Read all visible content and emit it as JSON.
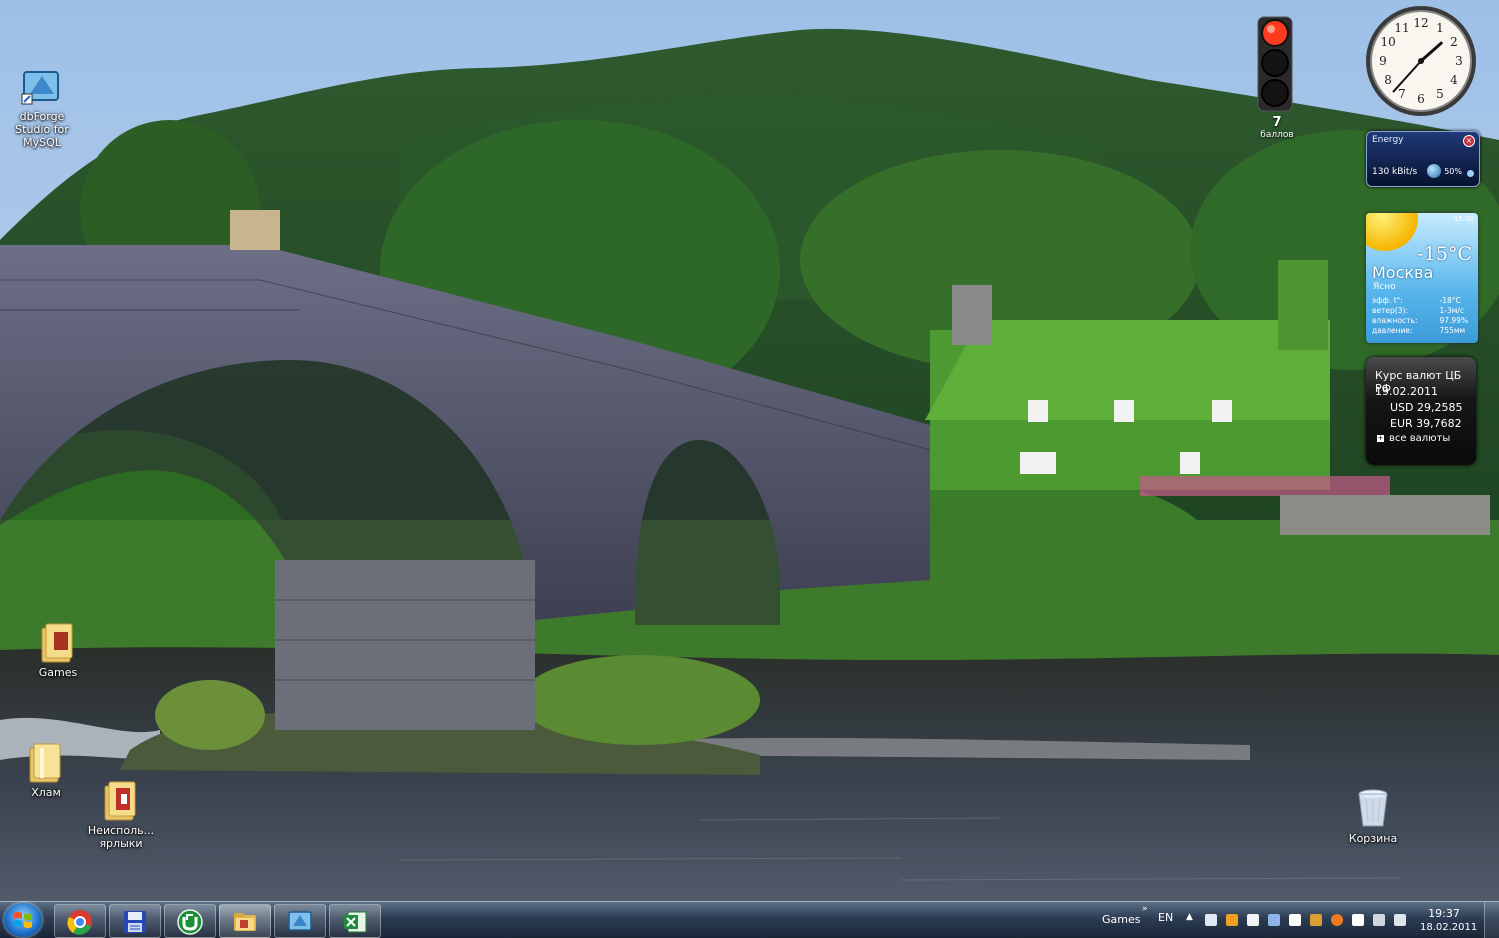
{
  "desktop": {
    "icons": [
      {
        "label": "dbForge Studio for MySQL"
      },
      {
        "label": "Games"
      },
      {
        "label": "Хлам"
      },
      {
        "label": "Неисполь... ярлыки"
      },
      {
        "label": "Корзина"
      }
    ]
  },
  "gadgets": {
    "traffic_light": {
      "score": "7",
      "score_label": "баллов"
    },
    "clock": {
      "time": "13:37",
      "numerals": [
        "12",
        "1",
        "2",
        "3",
        "4",
        "5",
        "6",
        "7",
        "8",
        "9",
        "10",
        "11"
      ]
    },
    "energy": {
      "title": "Energy",
      "speed": "130 kBit/s",
      "percent": "50%"
    },
    "weather": {
      "time": "15:00",
      "temperature": "-15°C",
      "city": "Москва",
      "condition": "Ясно",
      "rows": [
        {
          "label": "эфф. t°:",
          "value": "-18°C"
        },
        {
          "label": "ветер(З):",
          "value": "1-3м/с"
        },
        {
          "label": "влажность:",
          "value": "97.99%"
        },
        {
          "label": "давление:",
          "value": "755мм"
        }
      ]
    },
    "currency": {
      "title": "Курс валют ЦБ РФ",
      "date": "19.02.2011",
      "usd": "USD 29,2585",
      "eur": "EUR 39,7682",
      "all_link": "все валюты"
    }
  },
  "taskbar": {
    "pinned": [
      "chrome",
      "save-disk",
      "utorrent",
      "folder",
      "dbforge",
      "excel"
    ],
    "tray": {
      "toolbar_label": "Games",
      "chevron": "»",
      "language": "EN",
      "time": "19:37",
      "date": "18.02.2011"
    }
  },
  "colors": {
    "taskbar": "#2c3c52",
    "weather_accent": "#58b6ec",
    "traffic_red": "#ff3b1f"
  }
}
